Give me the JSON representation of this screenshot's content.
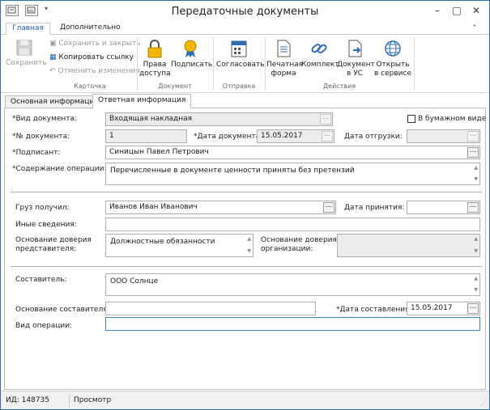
{
  "window": {
    "title": "Передаточные документы"
  },
  "controls": {
    "minimize": "–",
    "maximize": "□",
    "close": "✕"
  },
  "ribbon_tabs": [
    "Главная",
    "Дополнительно"
  ],
  "ribbon": {
    "groups": {
      "card": "Карточка",
      "document": "Документ",
      "send": "Отправка",
      "actions": "Действия"
    },
    "save": "Сохранить",
    "save_close": "Сохранить и закрыть",
    "copy_link": "Копировать ссылку",
    "undo": "Отменить изменения",
    "access_1": "Права",
    "access_2": "доступа",
    "sign": "Подписать",
    "approve": "Согласовать",
    "print_1": "Печатная",
    "print_2": "форма",
    "kit": "Комплект",
    "doc_us_1": "Документ",
    "doc_us_2": "в УС",
    "open_service_1": "Открыть",
    "open_service_2": "в сервисе"
  },
  "doc_tabs": [
    "Основная информация",
    "Ответная информация"
  ],
  "form": {
    "doc_type_label": "*Вид документа:",
    "doc_type_value": "Входящая накладная",
    "paper_label": "В бумажном виде",
    "doc_num_label": "*№ документа:",
    "doc_num_value": "1",
    "doc_date_label": "*Дата документа:",
    "doc_date_value": "15.05.2017",
    "ship_date_label": "Дата отгрузки:",
    "signer_label": "*Подписант:",
    "signer_value": "Синицын Павел Петрович",
    "content_label": "*Содержание операции:",
    "content_value": "Перечисленные в документе ценности приняты без претензий",
    "cargo_label": "Груз получил:",
    "cargo_value": "Иванов Иван Иванович",
    "accept_date_label": "Дата принятия:",
    "other_label": "Иные сведения:",
    "rep_basis_label_1": "Основание доверия",
    "rep_basis_label_2": "представителя:",
    "rep_basis_value": "Должностные обязанности",
    "org_basis_label_1": "Основание доверия",
    "org_basis_label_2": "организации:",
    "compiler_label": "Составитель:",
    "compiler_value": "ООО Солнце",
    "compiler_basis_label": "Основание составителя:",
    "compile_date_label": "*Дата составления:",
    "compile_date_value": "15.05.2017",
    "op_type_label": "Вид операции:"
  },
  "status": {
    "id": "ИД: 148735",
    "mode": "Просмотр"
  },
  "colors": {
    "accent": "#1e5ca8",
    "frame": "#2b6fb6"
  }
}
